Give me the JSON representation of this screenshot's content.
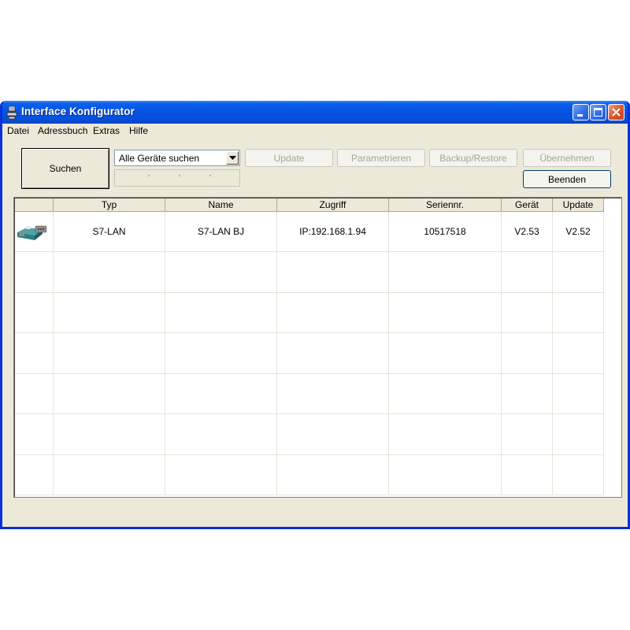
{
  "window": {
    "title": "Interface Konfigurator",
    "accent_color": "#0554e3",
    "icons": {
      "app": "network-device-icon",
      "minimize": "minimize-icon",
      "maximize": "maximize-icon",
      "close": "close-icon"
    }
  },
  "menu": {
    "items": [
      "Datei",
      "Adressbuch",
      "Extras",
      "Hilfe"
    ]
  },
  "toolbar": {
    "search_label": "Suchen",
    "search_mode": "Alle Geräte suchen",
    "buttons": {
      "update": "Update",
      "parametrieren": "Parametrieren",
      "backup_restore": "Backup/Restore",
      "uebernehmen": "Übernehmen",
      "beenden": "Beenden"
    }
  },
  "table": {
    "columns": [
      "",
      "Typ",
      "Name",
      "Zugriff",
      "Seriennr.",
      "Gerät",
      "Update"
    ],
    "rows": [
      {
        "icon": "s7-lan-adapter-icon",
        "typ": "S7-LAN",
        "name": "S7-LAN BJ",
        "zugriff": "IP:192.168.1.94",
        "seriennr": "10517518",
        "geraet": "V2.53",
        "update": "V2.52"
      }
    ]
  }
}
